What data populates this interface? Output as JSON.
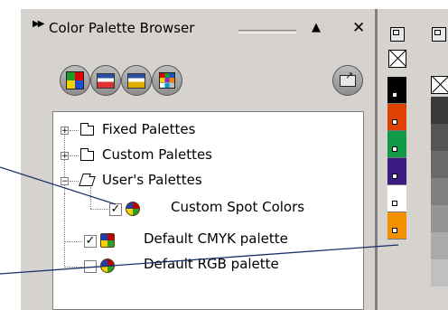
{
  "docker": {
    "title": "Color Palette Browser",
    "title_icon": "double-chevron-right-icon",
    "collapse_icon": "triangle-up-icon",
    "close_icon": "close-x-icon"
  },
  "toolbar": {
    "buttons": [
      {
        "name": "new-palette-from-selection-button",
        "icon": "palette-grid-icon"
      },
      {
        "name": "new-palette-from-document-button",
        "icon": "window-palette-icon"
      },
      {
        "name": "create-new-palette-button",
        "icon": "window-palette-icon"
      },
      {
        "name": "palette-editor-button",
        "icon": "color-grid-icon"
      },
      {
        "name": "open-palette-button",
        "icon": "folder-arrow-icon"
      }
    ]
  },
  "tree": {
    "items": [
      {
        "label": "Fixed Palettes",
        "type": "folder",
        "expander": "+"
      },
      {
        "label": "Custom Palettes",
        "type": "folder",
        "expander": "+"
      },
      {
        "label": "User's Palettes",
        "type": "open-folder",
        "expander": "−"
      },
      {
        "label": "Custom Spot Colors",
        "type": "palette",
        "checked": true,
        "check_mark": "✓"
      },
      {
        "label": "Default CMYK palette",
        "type": "palette",
        "checked": true,
        "check_mark": "✓"
      },
      {
        "label": "Default RGB palette",
        "type": "palette",
        "checked": false,
        "check_mark": ""
      }
    ]
  },
  "palette_strip": {
    "colors": [
      "#000000",
      "#e04000",
      "#109a48",
      "#3c1a82",
      "#ffffff",
      "#f39100"
    ],
    "grays": [
      "#3a3a3a",
      "#555555",
      "#6a6a6a",
      "#808080",
      "#959595",
      "#aaaaaa",
      "#c0c0c0"
    ]
  },
  "colors": {
    "panel_bg": "#d6d3ce",
    "callout_line": "#1a2e6b"
  }
}
